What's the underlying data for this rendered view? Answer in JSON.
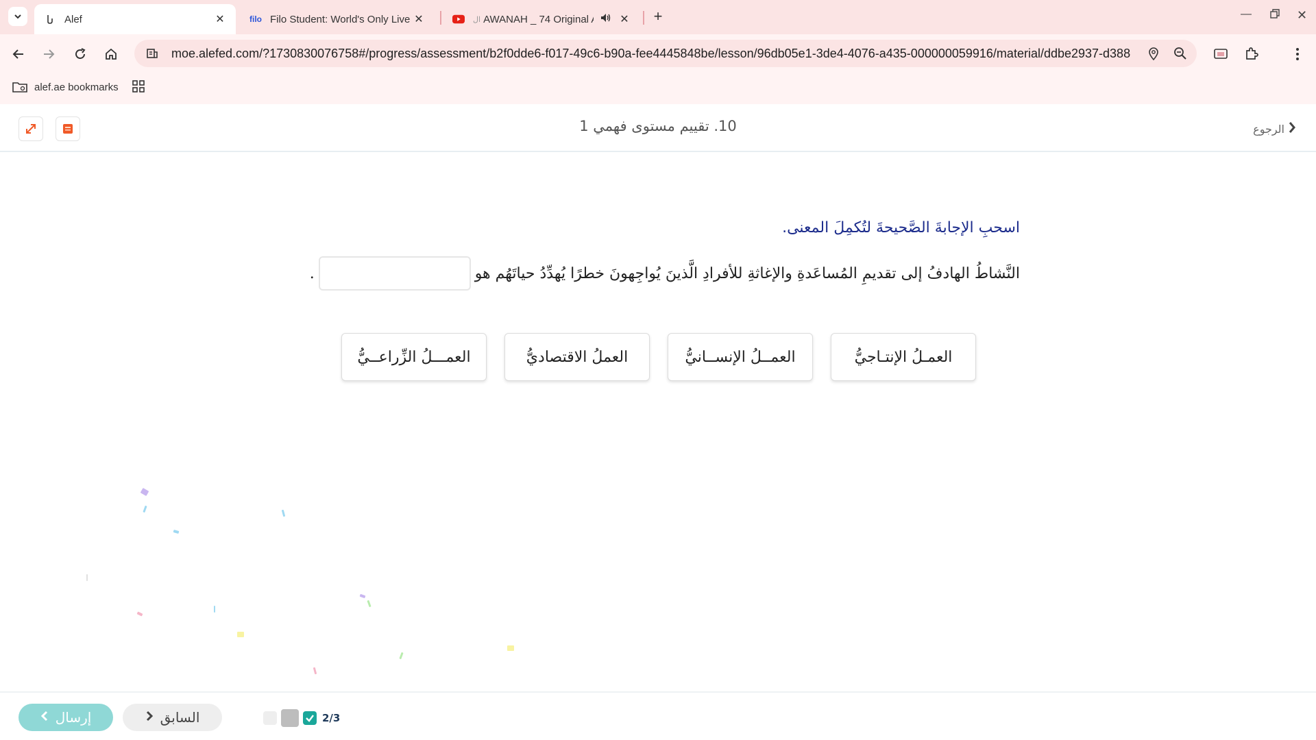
{
  "browser": {
    "tabs": [
      {
        "title": "Alef",
        "active": true
      },
      {
        "title": "Filo Student: World's Only Live I",
        "favicon_text": "filo"
      },
      {
        "title": "AWANAH _ 74 Original AE",
        "favicon_prefix": "ال"
      }
    ],
    "url": "moe.alefed.com/?1730830076758#/progress/assessment/b2f0dde6-f017-49c6-b90a-fee4445848be/lesson/96db05e1-3de4-4076-a435-000000059916/material/ddbe2937-d388-4...",
    "bookmark_folder": "alef.ae bookmarks",
    "colors": {
      "chrome_bg": "#fbe4e4",
      "toolbar_bg": "#fff3f3"
    }
  },
  "header": {
    "lesson_title": "10. تقييم مستوى فهمي 1",
    "back_label": "الرجوع"
  },
  "question": {
    "instruction": "اسحبِ الإجابةَ الصَّحيحةَ لتُكمِلَ المعنى.",
    "sentence_before": "النَّشاطُ الهادفُ إلى تقديمِ المُساعَدةِ والإغاثةِ للأفرادِ الَّذينَ يُواجِهونَ خطرًا يُهدِّدُ حياتَهُم هو",
    "sentence_after": ".",
    "options": [
      "العمـلُ الإنتـاجيُّ",
      "العمــلُ الإنســانيُّ",
      "العملُ الاقتصاديُّ",
      "العمـــلُ الزِّراعــيُّ"
    ]
  },
  "footer": {
    "send_label": "إرسال",
    "prev_label": "السابق",
    "progress_text": "2/3",
    "colors": {
      "send_bg": "#8fd8d6",
      "progress_done": "#1aa79a"
    }
  }
}
